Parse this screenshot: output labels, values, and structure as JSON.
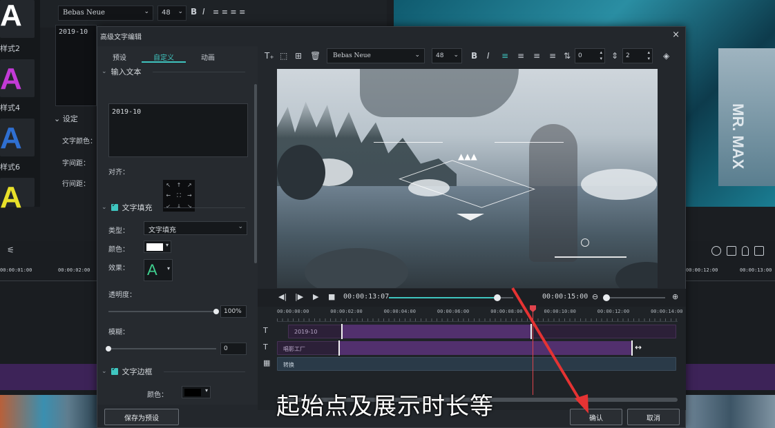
{
  "background": {
    "font_name": "Bebas Neue",
    "font_size": "48",
    "text_preview": "2019-10",
    "style_labels": [
      "样式2",
      "样式4",
      "样式6"
    ],
    "settings_title": "设定",
    "settings_items": [
      "文字颜色：",
      "字间距：",
      "行间距："
    ],
    "ruler_ticks": [
      "00:00:01:00",
      "00:00:02:00"
    ],
    "ruler_ticks_right": [
      "00:00:12:00",
      "00:00:13:00"
    ],
    "preview_text": "MR. MAX"
  },
  "dialog": {
    "title": "高级文字编辑",
    "close_label": "×",
    "tabs": [
      "预设",
      "自定义",
      "动画"
    ],
    "active_tab": 1,
    "sections": {
      "input_text": {
        "title": "输入文本",
        "value": "2019-10",
        "align_label": "对齐："
      },
      "text_fill": {
        "title": "文字填充",
        "checked": true,
        "type_label": "类型：",
        "type_value": "文字填充",
        "color_label": "颜色：",
        "color_value": "#ffffff",
        "effect_label": "效果：",
        "effect_glyph": "A",
        "opacity_label": "透明度：",
        "opacity_value": "100%",
        "opacity_fraction": 1.0,
        "blur_label": "模糊：",
        "blur_value": "0",
        "blur_fraction": 0.0
      },
      "text_border": {
        "title": "文字边框",
        "checked": true,
        "color_label": "颜色：",
        "color_value": "#000000"
      }
    },
    "toolbar": {
      "font_name": "Bebas Neue",
      "font_size": "48",
      "bold": "B",
      "italic": "I",
      "char_spacing": "0",
      "line_spacing": "2"
    },
    "playback": {
      "current_time": "00:00:13:07",
      "total_time": "00:00:15:00",
      "progress_fraction": 0.87
    },
    "timeline": {
      "ticks": [
        "00:00:00:00",
        "00:00:02:00",
        "00:00:04:00",
        "00:00:06:00",
        "00:00:08:00",
        "00:00:10:00",
        "00:00:12:00",
        "00:00:14:00"
      ],
      "tracks": [
        {
          "icon": "T",
          "clip_label": "2019-10"
        },
        {
          "icon": "T",
          "clip_label": "唱影工厂"
        },
        {
          "icon": "▦",
          "clip_label": "转换"
        }
      ]
    },
    "buttons": {
      "save_preset": "保存为预设",
      "ok": "确认",
      "cancel": "取消"
    }
  },
  "subtitle": "起始点及展示时长等",
  "colors": {
    "accent": "#3fc6c0",
    "playhead": "#e0444d",
    "clip_purple": "#52306e",
    "arrow": "#e53333"
  }
}
